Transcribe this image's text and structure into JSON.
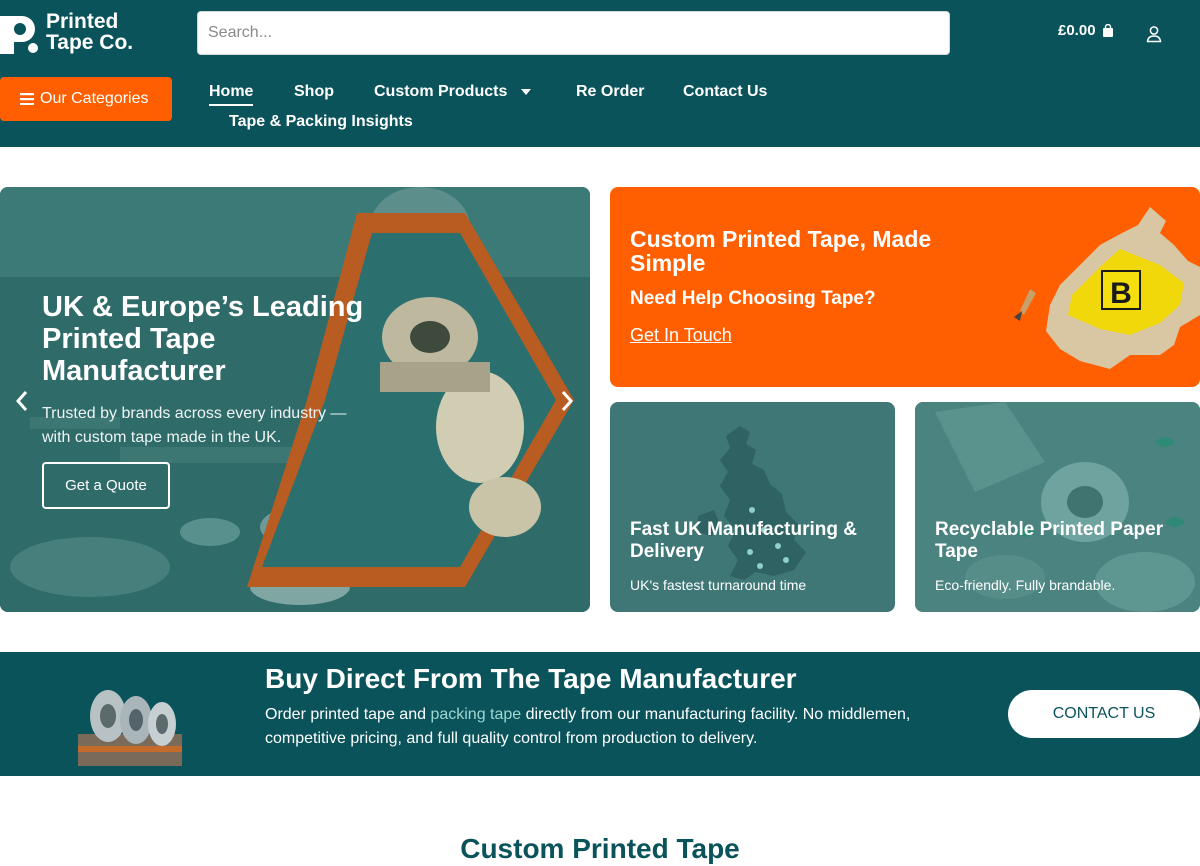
{
  "brand": {
    "line1": "Printed",
    "line2": "Tape Co."
  },
  "search": {
    "placeholder": "Search..."
  },
  "cart": {
    "total": "£0.00"
  },
  "categories_button": "Our Categories",
  "nav": {
    "home": "Home",
    "shop": "Shop",
    "custom_products": "Custom Products",
    "reorder": "Re Order",
    "contact": "Contact Us",
    "insights": "Tape & Packing Insights"
  },
  "hero": {
    "title_line1": "UK & Europe’s Leading",
    "title_line2": "Printed Tape",
    "title_line3": "Manufacturer",
    "subtitle_line1": "Trusted by brands across every industry —",
    "subtitle_line2": "with custom tape made in the UK.",
    "cta": "Get a Quote"
  },
  "promo": {
    "title_line1": "Custom Printed Tape, Made",
    "title_line2": "Simple",
    "subtitle": "Need Help Choosing Tape?",
    "link": "Get In Touch"
  },
  "card_uk": {
    "title_line1": "Fast UK Manufacturing &",
    "title_line2": "Delivery",
    "subtitle": "UK's fastest turnaround time"
  },
  "card_eco": {
    "title_line1": "Recyclable Printed Paper",
    "title_line2": "Tape",
    "subtitle": "Eco-friendly. Fully brandable."
  },
  "band": {
    "title": "Buy Direct From The Tape Manufacturer",
    "text_before": "Order printed tape and ",
    "text_link": "packing tape",
    "text_after": " directly from our manufacturing facility. No middlemen,",
    "text_line2": "competitive pricing, and full quality control from production to delivery.",
    "button": "CONTACT US"
  },
  "section_heading": "Custom Printed Tape",
  "icons": {
    "menu": "hamburger-icon",
    "cart": "shopping-bag-icon",
    "user": "user-icon",
    "dropdown": "caret-down-icon",
    "prev": "chevron-left-icon",
    "next": "chevron-right-icon"
  },
  "colors": {
    "brand_teal": "#0a535b",
    "accent_orange": "#ff5f00",
    "link_teal": "#9fd6d2"
  }
}
